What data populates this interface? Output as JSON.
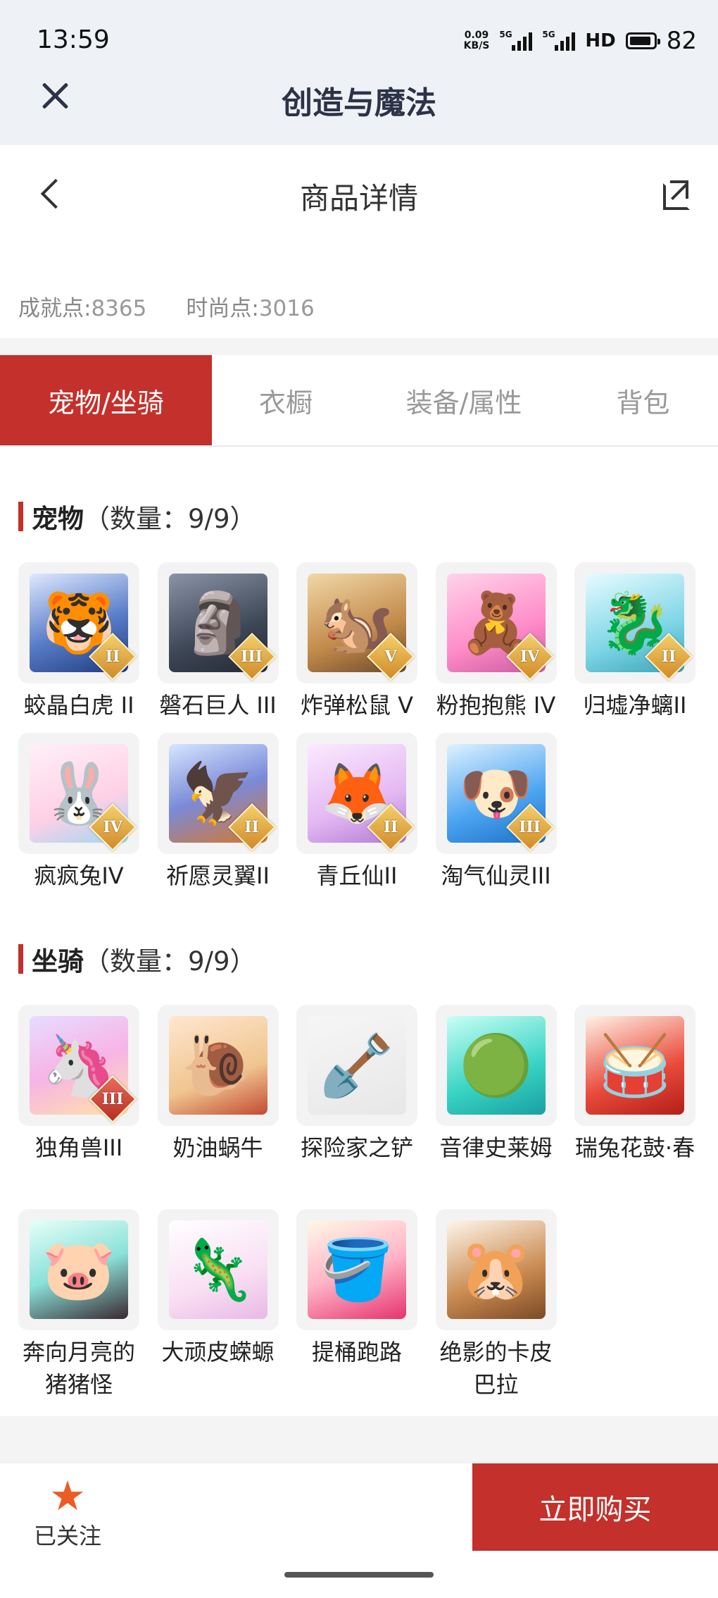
{
  "status_bar": {
    "time": "13:59",
    "net_speed_value": "0.09",
    "net_speed_unit": "KB/S",
    "signal1_label": "5G",
    "signal2_label": "5G",
    "hd_label": "HD",
    "battery_level": "82"
  },
  "app_header": {
    "title": "创造与魔法"
  },
  "page_header": {
    "title": "商品详情"
  },
  "points": {
    "achievement_label": "成就点:",
    "achievement_value": "8365",
    "fashion_label": "时尚点:",
    "fashion_value": "3016"
  },
  "tabs": [
    {
      "label": "宠物/坐骑",
      "active": true
    },
    {
      "label": "衣橱",
      "active": false
    },
    {
      "label": "装备/属性",
      "active": false
    },
    {
      "label": "背包",
      "active": false
    }
  ],
  "pets_section": {
    "title": "宠物",
    "count_text": "（数量：9/9）",
    "items": [
      {
        "name": "蛟晶白虎 II",
        "icon": "white-tiger",
        "rank": "II"
      },
      {
        "name": "磐石巨人 III",
        "icon": "rock-giant",
        "rank": "III"
      },
      {
        "name": "炸弹松鼠 V",
        "icon": "bomb-squirrel",
        "rank": "V"
      },
      {
        "name": "粉抱抱熊 IV",
        "icon": "pink-bear",
        "rank": "IV"
      },
      {
        "name": "归墟净螭II",
        "icon": "dragon",
        "rank": "II"
      },
      {
        "name": "疯疯兔IV",
        "icon": "rabbit",
        "rank": "IV"
      },
      {
        "name": "祈愿灵翼II",
        "icon": "eagle",
        "rank": "II"
      },
      {
        "name": "青丘仙II",
        "icon": "fox-fairy",
        "rank": "II"
      },
      {
        "name": "淘气仙灵III",
        "icon": "blue-dog",
        "rank": "III"
      }
    ]
  },
  "mounts_section": {
    "title": "坐骑",
    "count_text": "（数量：9/9）",
    "items": [
      {
        "name": "独角兽III",
        "icon": "unicorn",
        "rank": "III"
      },
      {
        "name": "奶油蜗牛",
        "icon": "snail",
        "rank": ""
      },
      {
        "name": "探险家之铲",
        "icon": "shovel",
        "rank": ""
      },
      {
        "name": "音律史莱姆",
        "icon": "slime",
        "rank": ""
      },
      {
        "name": "瑞兔花鼓·春",
        "icon": "drum",
        "rank": ""
      },
      {
        "name": "奔向月亮的猪猪怪",
        "icon": "pig",
        "rank": ""
      },
      {
        "name": "大顽皮蝾螈",
        "icon": "axolotl",
        "rank": ""
      },
      {
        "name": "提桶跑路",
        "icon": "bucket",
        "rank": ""
      },
      {
        "name": "绝影的卡皮巴拉",
        "icon": "capybara",
        "rank": ""
      }
    ]
  },
  "bottom_bar": {
    "follow_label": "已关注",
    "follow_icon": "star-icon",
    "buy_label": "立即购买"
  },
  "colors": {
    "accent": "#c4302b",
    "star": "#ee5a24"
  }
}
